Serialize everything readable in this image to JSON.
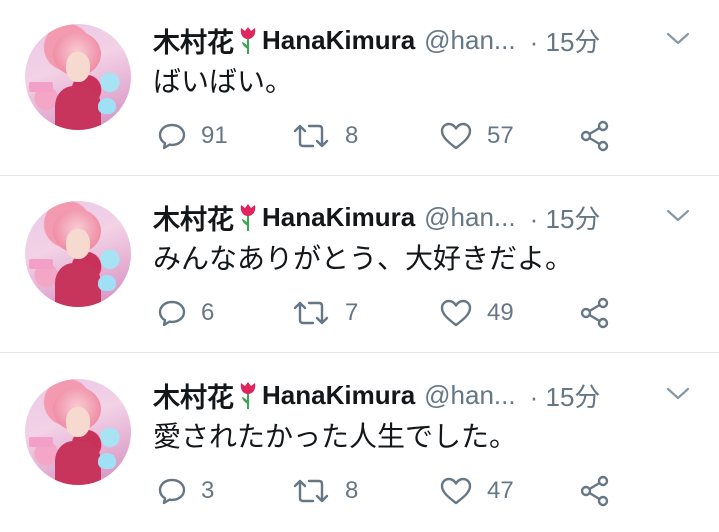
{
  "tweets": [
    {
      "display_name": "木村花",
      "display_name_en": "HanaKimura",
      "handle": "@han...",
      "time": "· 15分",
      "text": "ばいばい。",
      "replies": "91",
      "retweets": "8",
      "likes": "57"
    },
    {
      "display_name": "木村花",
      "display_name_en": "HanaKimura",
      "handle": "@han...",
      "time": "· 15分",
      "text": "みんなありがとう、大好きだよ。",
      "replies": "6",
      "retweets": "7",
      "likes": "49"
    },
    {
      "display_name": "木村花",
      "display_name_en": "HanaKimura",
      "handle": "@han...",
      "time": "· 15分",
      "text": "愛されたかった人生でした。",
      "replies": "3",
      "retweets": "8",
      "likes": "47"
    }
  ],
  "icons": {
    "avatar": "profile-photo",
    "name_emoji": "tulip-icon",
    "menu": "chevron-down-icon",
    "reply": "reply-icon",
    "retweet": "retweet-icon",
    "like": "heart-icon",
    "share": "share-icon"
  },
  "colors": {
    "text": "#14171a",
    "secondary": "#657786",
    "divider": "#e1e8ed",
    "tulip": "#e0245e"
  }
}
